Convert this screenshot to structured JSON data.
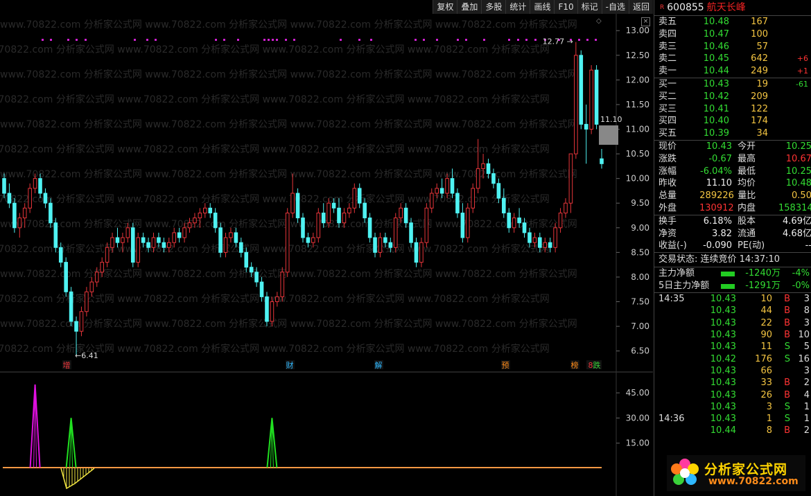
{
  "toolbar": [
    "复权",
    "叠加",
    "多股",
    "统计",
    "画线",
    "F10",
    "标记",
    "-自选",
    "返回"
  ],
  "watermark": "www.70822.com 分析家公式网",
  "chart_data": [
    {
      "type": "candlestick",
      "ylim": [
        6.2,
        13.2
      ],
      "yticks": [
        "13.00",
        "12.50",
        "12.00",
        "11.50",
        "11.00",
        "10.50",
        "10.00",
        "9.50",
        "9.00",
        "8.50",
        "8.00",
        "7.50",
        "7.00",
        "6.50"
      ],
      "high_label": "12.77",
      "low_label": "6.41",
      "last_label": "11.10",
      "ohlc": [
        [
          10.0,
          10.1,
          9.6,
          9.7
        ],
        [
          9.7,
          9.9,
          9.4,
          9.5
        ],
        [
          9.5,
          9.6,
          8.9,
          9.0
        ],
        [
          9.0,
          9.3,
          8.8,
          9.2
        ],
        [
          9.2,
          9.5,
          9.0,
          9.4
        ],
        [
          9.4,
          9.9,
          9.3,
          9.8
        ],
        [
          9.8,
          10.1,
          9.7,
          10.0
        ],
        [
          10.0,
          10.1,
          9.6,
          9.7
        ],
        [
          9.7,
          9.8,
          9.4,
          9.5
        ],
        [
          9.5,
          9.6,
          9.0,
          9.1
        ],
        [
          9.1,
          9.2,
          8.5,
          8.6
        ],
        [
          8.6,
          8.7,
          8.2,
          8.3
        ],
        [
          8.3,
          8.4,
          7.6,
          7.7
        ],
        [
          7.7,
          7.8,
          7.0,
          7.1
        ],
        [
          7.1,
          7.2,
          6.41,
          6.9
        ],
        [
          6.9,
          7.4,
          6.8,
          7.3
        ],
        [
          7.3,
          7.8,
          7.2,
          7.7
        ],
        [
          7.7,
          8.0,
          7.6,
          7.9
        ],
        [
          7.9,
          8.2,
          7.8,
          8.1
        ],
        [
          8.1,
          8.4,
          8.0,
          8.3
        ],
        [
          8.3,
          8.7,
          8.2,
          8.6
        ],
        [
          8.6,
          8.9,
          8.5,
          8.8
        ],
        [
          8.8,
          9.0,
          8.6,
          8.7
        ],
        [
          8.7,
          8.9,
          8.5,
          8.8
        ],
        [
          8.8,
          9.1,
          8.7,
          9.0
        ],
        [
          9.0,
          9.1,
          8.2,
          8.3
        ],
        [
          8.3,
          8.9,
          8.2,
          8.8
        ],
        [
          8.8,
          8.9,
          8.6,
          8.7
        ],
        [
          8.7,
          8.8,
          8.5,
          8.6
        ],
        [
          8.6,
          8.9,
          8.5,
          8.8
        ],
        [
          8.8,
          8.9,
          8.6,
          8.7
        ],
        [
          8.7,
          8.8,
          8.5,
          8.6
        ],
        [
          8.6,
          8.8,
          8.5,
          8.7
        ],
        [
          8.7,
          9.0,
          8.6,
          8.9
        ],
        [
          8.9,
          9.0,
          8.7,
          8.8
        ],
        [
          8.8,
          9.1,
          8.7,
          9.0
        ],
        [
          9.0,
          9.2,
          8.9,
          9.1
        ],
        [
          9.1,
          9.3,
          9.0,
          9.2
        ],
        [
          9.2,
          9.4,
          9.0,
          9.3
        ],
        [
          9.3,
          9.5,
          9.2,
          9.4
        ],
        [
          9.4,
          9.5,
          9.2,
          9.3
        ],
        [
          9.3,
          9.4,
          8.9,
          9.0
        ],
        [
          9.0,
          9.1,
          8.4,
          8.5
        ],
        [
          8.5,
          8.9,
          8.4,
          8.8
        ],
        [
          8.8,
          9.0,
          8.7,
          8.9
        ],
        [
          8.9,
          9.0,
          8.6,
          8.7
        ],
        [
          8.7,
          8.8,
          8.4,
          8.5
        ],
        [
          8.5,
          8.6,
          8.1,
          8.2
        ],
        [
          8.2,
          8.3,
          8.0,
          8.1
        ],
        [
          8.1,
          8.2,
          7.8,
          7.9
        ],
        [
          7.9,
          8.0,
          7.5,
          7.6
        ],
        [
          7.6,
          7.7,
          7.0,
          7.1
        ],
        [
          7.1,
          7.6,
          7.0,
          7.5
        ],
        [
          7.5,
          7.7,
          7.4,
          7.6
        ],
        [
          7.6,
          8.2,
          7.5,
          8.1
        ],
        [
          8.1,
          9.4,
          8.0,
          9.3
        ],
        [
          9.3,
          10.1,
          9.2,
          9.7
        ],
        [
          9.7,
          9.8,
          9.1,
          9.2
        ],
        [
          9.2,
          9.3,
          8.7,
          8.8
        ],
        [
          8.8,
          8.9,
          8.6,
          8.7
        ],
        [
          8.7,
          8.9,
          8.6,
          8.8
        ],
        [
          8.8,
          9.4,
          8.7,
          9.3
        ],
        [
          9.3,
          9.5,
          9.0,
          9.1
        ],
        [
          9.1,
          9.6,
          9.0,
          9.5
        ],
        [
          9.5,
          9.6,
          9.3,
          9.4
        ],
        [
          9.4,
          9.6,
          9.0,
          9.1
        ],
        [
          9.1,
          9.4,
          9.0,
          9.3
        ],
        [
          9.3,
          9.5,
          9.2,
          9.4
        ],
        [
          9.4,
          9.9,
          9.3,
          9.8
        ],
        [
          9.8,
          9.9,
          9.4,
          9.5
        ],
        [
          9.5,
          9.6,
          9.1,
          9.2
        ],
        [
          9.2,
          9.3,
          8.7,
          8.8
        ],
        [
          8.8,
          8.9,
          8.4,
          8.5
        ],
        [
          8.5,
          8.9,
          8.4,
          8.8
        ],
        [
          8.8,
          8.9,
          8.6,
          8.7
        ],
        [
          8.7,
          8.8,
          8.5,
          8.6
        ],
        [
          8.6,
          9.3,
          8.5,
          9.2
        ],
        [
          9.2,
          9.5,
          9.1,
          9.4
        ],
        [
          9.4,
          9.5,
          9.0,
          9.1
        ],
        [
          9.1,
          9.2,
          8.6,
          8.7
        ],
        [
          8.7,
          8.8,
          8.2,
          8.3
        ],
        [
          8.3,
          8.8,
          8.2,
          8.7
        ],
        [
          8.7,
          9.5,
          8.6,
          9.4
        ],
        [
          9.4,
          9.8,
          9.3,
          9.7
        ],
        [
          9.7,
          9.9,
          9.6,
          9.8
        ],
        [
          9.8,
          10.0,
          9.6,
          9.7
        ],
        [
          9.7,
          10.1,
          9.6,
          10.0
        ],
        [
          10.0,
          10.2,
          9.6,
          9.7
        ],
        [
          9.7,
          9.8,
          9.2,
          9.3
        ],
        [
          9.3,
          9.5,
          8.7,
          8.8
        ],
        [
          8.8,
          9.5,
          8.7,
          9.4
        ],
        [
          9.4,
          9.9,
          9.3,
          9.8
        ],
        [
          9.8,
          10.8,
          9.7,
          10.2
        ],
        [
          10.2,
          10.5,
          10.0,
          10.3
        ],
        [
          10.3,
          10.4,
          10.0,
          10.1
        ],
        [
          10.1,
          10.2,
          9.8,
          9.9
        ],
        [
          9.9,
          10.0,
          9.5,
          9.6
        ],
        [
          9.6,
          9.8,
          9.2,
          9.3
        ],
        [
          9.3,
          9.4,
          8.9,
          9.0
        ],
        [
          9.0,
          9.3,
          8.9,
          9.2
        ],
        [
          9.2,
          9.4,
          9.0,
          9.1
        ],
        [
          9.1,
          9.2,
          8.8,
          8.9
        ],
        [
          8.9,
          9.0,
          8.6,
          8.7
        ],
        [
          8.7,
          8.9,
          8.6,
          8.8
        ],
        [
          8.8,
          8.9,
          8.5,
          8.6
        ],
        [
          8.6,
          8.8,
          8.5,
          8.7
        ],
        [
          8.7,
          8.8,
          8.5,
          8.6
        ],
        [
          8.6,
          9.1,
          8.5,
          9.0
        ],
        [
          9.0,
          9.4,
          8.9,
          9.3
        ],
        [
          9.3,
          9.6,
          9.2,
          9.5
        ],
        [
          9.5,
          10.5,
          9.3,
          10.5
        ],
        [
          10.5,
          12.77,
          10.4,
          12.5
        ],
        [
          12.5,
          12.6,
          11.0,
          11.1
        ],
        [
          11.1,
          11.5,
          10.3,
          11.0
        ],
        [
          11.0,
          12.3,
          10.9,
          12.2
        ],
        [
          12.2,
          12.3,
          11.0,
          11.1
        ],
        [
          10.4,
          10.6,
          10.2,
          10.3
        ]
      ],
      "markers": [
        "增",
        "财",
        "解",
        "预",
        "榜",
        "8",
        "跌"
      ]
    },
    {
      "type": "indicator",
      "ylim": [
        0,
        50
      ],
      "yticks": [
        "45.00",
        "30.00",
        "15.00"
      ],
      "spikes": [
        {
          "x": 6,
          "value": 50,
          "color": "#e010e0"
        },
        {
          "x": 13,
          "value": 30,
          "color": "#20e020"
        },
        {
          "x": 52,
          "value": 30,
          "color": "#20e020"
        }
      ]
    }
  ],
  "quote": {
    "r": "R",
    "code": "600855",
    "name": "航天长峰",
    "asks": [
      {
        "label": "卖五",
        "price": "10.48",
        "vol": "167",
        "chg": ""
      },
      {
        "label": "卖四",
        "price": "10.47",
        "vol": "100",
        "chg": ""
      },
      {
        "label": "卖三",
        "price": "10.46",
        "vol": "57",
        "chg": ""
      },
      {
        "label": "卖二",
        "price": "10.45",
        "vol": "642",
        "chg": "+6"
      },
      {
        "label": "卖一",
        "price": "10.44",
        "vol": "249",
        "chg": "+1"
      }
    ],
    "bids": [
      {
        "label": "买一",
        "price": "10.43",
        "vol": "19",
        "chg": "-61"
      },
      {
        "label": "买二",
        "price": "10.42",
        "vol": "209",
        "chg": ""
      },
      {
        "label": "买三",
        "price": "10.41",
        "vol": "122",
        "chg": ""
      },
      {
        "label": "买四",
        "price": "10.40",
        "vol": "174",
        "chg": ""
      },
      {
        "label": "买五",
        "price": "10.39",
        "vol": "34",
        "chg": ""
      }
    ],
    "stats": [
      [
        "现价",
        "10.43",
        "今开",
        "10.25"
      ],
      [
        "涨跌",
        "-0.67",
        "最高",
        "10.67"
      ],
      [
        "涨幅",
        "-6.04%",
        "最低",
        "10.25"
      ],
      [
        "昨收",
        "11.10",
        "均价",
        "10.48"
      ],
      [
        "总量",
        "289226",
        "量比",
        "0.50"
      ],
      [
        "外盘",
        "130912",
        "内盘",
        "158314"
      ]
    ],
    "stats2": [
      [
        "换手",
        "6.18%",
        "股本",
        "4.69亿"
      ],
      [
        "净资",
        "3.82",
        "流通",
        "4.68亿"
      ],
      [
        "收益(-)",
        "-0.090",
        "PE(动)",
        "--"
      ]
    ],
    "status": "交易状态: 连续竞价 14:37:10",
    "mainflow": [
      {
        "label": "主力净额",
        "value": "-1240万",
        "pct": "-4%"
      },
      {
        "label": "5日主力净额",
        "value": "-1291万",
        "pct": "-0%"
      }
    ],
    "ticks": [
      {
        "time": "14:35",
        "price": "10.43",
        "vol": "10",
        "side": "B",
        "n": "3"
      },
      {
        "time": "",
        "price": "10.43",
        "vol": "44",
        "side": "B",
        "n": "8"
      },
      {
        "time": "",
        "price": "10.43",
        "vol": "22",
        "side": "B",
        "n": "3"
      },
      {
        "time": "",
        "price": "10.43",
        "vol": "90",
        "side": "B",
        "n": "10"
      },
      {
        "time": "",
        "price": "10.43",
        "vol": "11",
        "side": "S",
        "n": "5"
      },
      {
        "time": "",
        "price": "10.42",
        "vol": "176",
        "side": "S",
        "n": "16"
      },
      {
        "time": "",
        "price": "10.43",
        "vol": "66",
        "side": "",
        "n": "3"
      },
      {
        "time": "",
        "price": "10.43",
        "vol": "33",
        "side": "B",
        "n": "2"
      },
      {
        "time": "",
        "price": "10.43",
        "vol": "26",
        "side": "B",
        "n": "4"
      },
      {
        "time": "",
        "price": "10.43",
        "vol": "3",
        "side": "S",
        "n": "1"
      },
      {
        "time": "14:36",
        "price": "10.43",
        "vol": "1",
        "side": "S",
        "n": "1"
      },
      {
        "time": "",
        "price": "10.44",
        "vol": "8",
        "side": "B",
        "n": "2"
      }
    ],
    "logo_title": "分析家公式网",
    "logo_url": "www.70822.com"
  }
}
